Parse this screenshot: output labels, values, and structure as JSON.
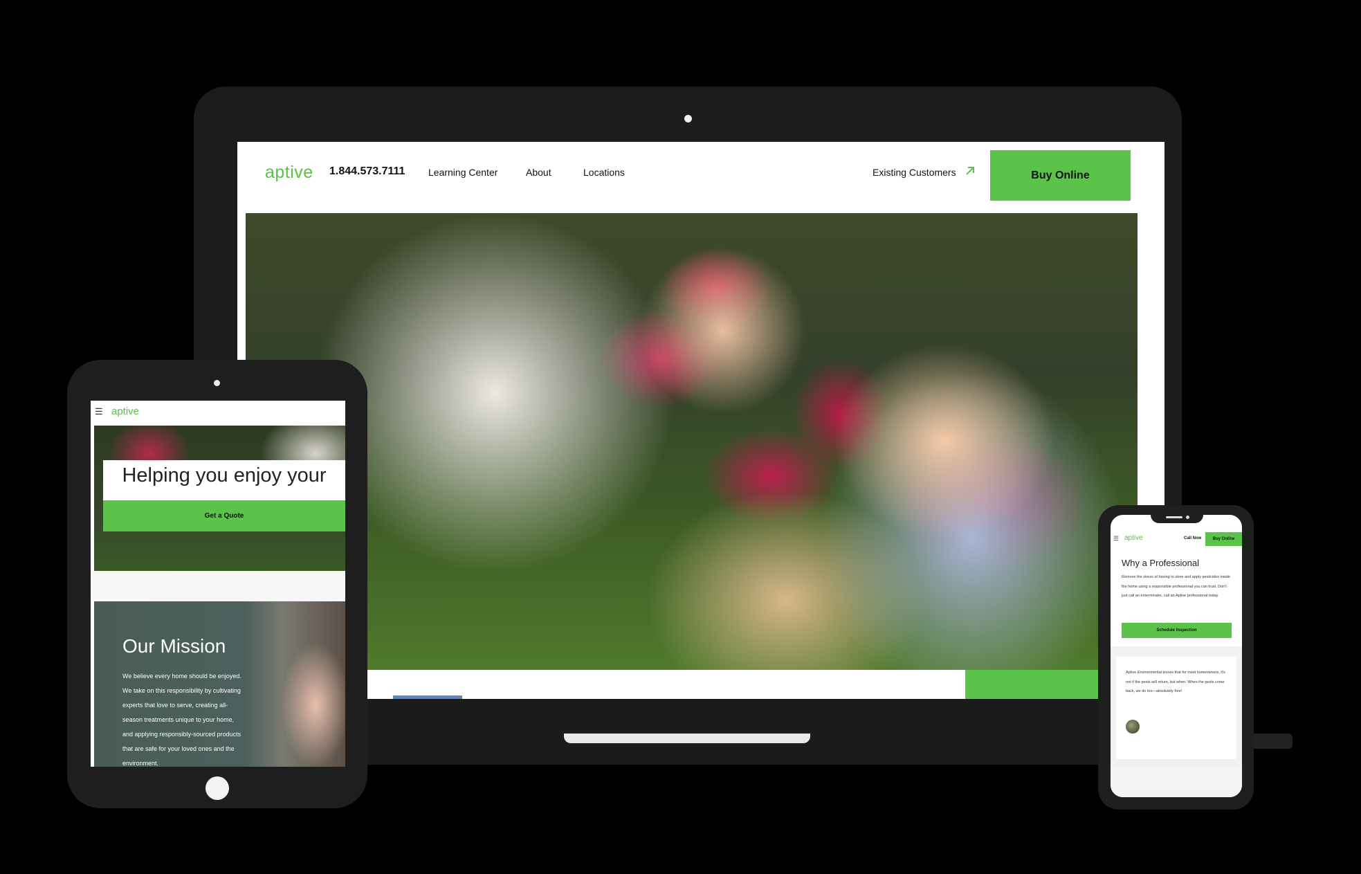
{
  "laptop_site": {
    "logo": "aptive",
    "phone": "1.844.573.7111",
    "nav": [
      "Learning Center",
      "About",
      "Locations"
    ],
    "existing_customers": "Existing Customers",
    "buy_online": "Buy Online"
  },
  "tablet_site": {
    "menu_icon": "☰",
    "logo": "aptive",
    "hero_heading": "Helping you enjoy your",
    "cta": "Get a Quote",
    "mission_title": "Our Mission",
    "mission_body": "We believe every home should be enjoyed. We take on this responsibility by cultivating experts that love to serve, creating all-season treatments unique to your home, and applying responsibly-sourced products that are safe for your loved ones and the environment."
  },
  "phone_site": {
    "menu_icon": "☰",
    "logo": "aptive",
    "call_now": "Call Now",
    "buy_online": "Buy Online",
    "title": "Why a Professional",
    "body": "Remove the stress of having to store and apply pesticides inside the home using a responsible professional you can trust. Don't just call an exterminator, call an Aptive professional today.",
    "schedule": "Schedule Inspection",
    "quote": "Aptive Environmental knows that for most homeowners, it's not if the pests will return, but when. When the pests come back, we do too—absolutely free!"
  },
  "colors": {
    "brand_green": "#5cc34a",
    "background": "#000000",
    "device_frame": "#1c1c1c"
  },
  "icons": [
    "hamburger-menu-icon",
    "external-arrow-icon",
    "camera-icon",
    "home-button-icon"
  ]
}
